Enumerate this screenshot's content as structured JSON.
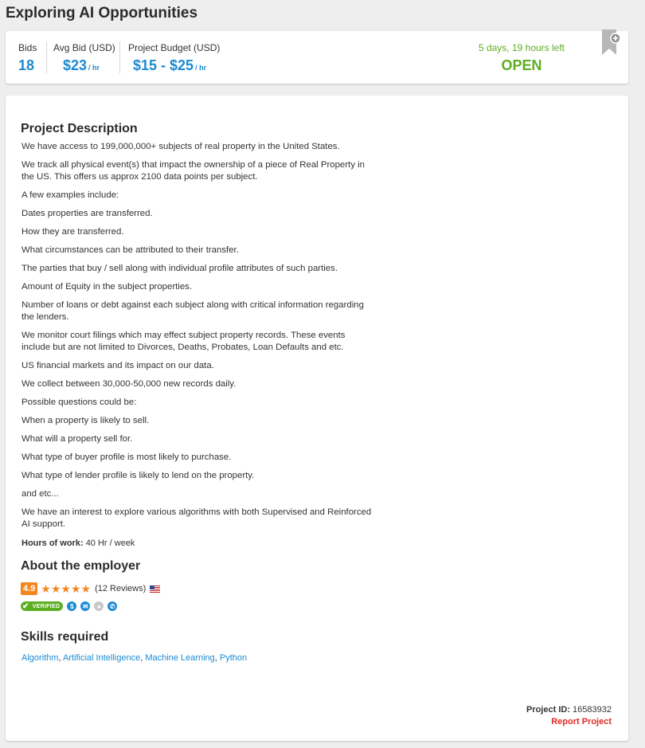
{
  "page": {
    "title": "Exploring AI Opportunities"
  },
  "summary": {
    "bids_label": "Bids",
    "bids_value": "18",
    "avg_bid_label": "Avg Bid (USD)",
    "avg_bid_value": "$23",
    "avg_bid_unit": "/ hr",
    "budget_label": "Project Budget (USD)",
    "budget_value": "$15 - $25",
    "budget_unit": "/ hr",
    "time_left": "5 days, 19 hours left",
    "status": "OPEN",
    "bookmark_icon": "bookmark-add-icon"
  },
  "description": {
    "heading": "Project Description",
    "paragraphs": [
      "We have access to 199,000,000+ subjects of real property in the United States.",
      "We track all physical event(s) that impact the ownership of a piece of Real Property in the US. This offers us approx 2100 data points per subject.",
      "A few examples include:",
      "Dates properties are transferred.",
      "How they are transferred.",
      "What circumstances can be attributed to their transfer.",
      "The parties that buy / sell along with individual profile attributes of such parties.",
      "Amount of Equity in the subject properties.",
      "Number of loans or debt against each subject along with critical information regarding the lenders.",
      "We monitor court filings which may effect subject property records. These events include but are not limited to Divorces, Deaths, Probates, Loan Defaults and etc.",
      "US financial markets and its impact on our data.",
      "We collect between 30,000-50,000 new records daily.",
      "Possible questions could be:",
      "When a property is likely to sell.",
      "What will a property sell for.",
      "What type of buyer profile is most likely to purchase.",
      "What type of lender profile is likely to lend on the property.",
      "and etc...",
      "We have an interest to explore various algorithms with both Supervised and Reinforced AI support."
    ],
    "hours_label": "Hours of work:",
    "hours_value": "40 Hr / week"
  },
  "employer": {
    "heading": "About the employer",
    "rating": "4.9",
    "stars": "★★★★★",
    "reviews": "(12 Reviews)",
    "flag_icon": "us-flag-icon",
    "verified_label": "VERIFIED",
    "verification_icons": [
      "payment-verified-icon",
      "email-verified-icon",
      "profile-unverified-icon",
      "phone-verified-icon"
    ]
  },
  "skills": {
    "heading": "Skills required",
    "items": [
      "Algorithm",
      "Artificial Intelligence",
      "Machine Learning",
      "Python"
    ]
  },
  "footer": {
    "project_id_label": "Project ID:",
    "project_id_value": "16583932",
    "report_label": "Report Project"
  },
  "colors": {
    "accent_blue": "#1b8ad3",
    "status_green": "#5dae22",
    "rating_orange": "#f5861f",
    "report_red": "#e02a25"
  }
}
